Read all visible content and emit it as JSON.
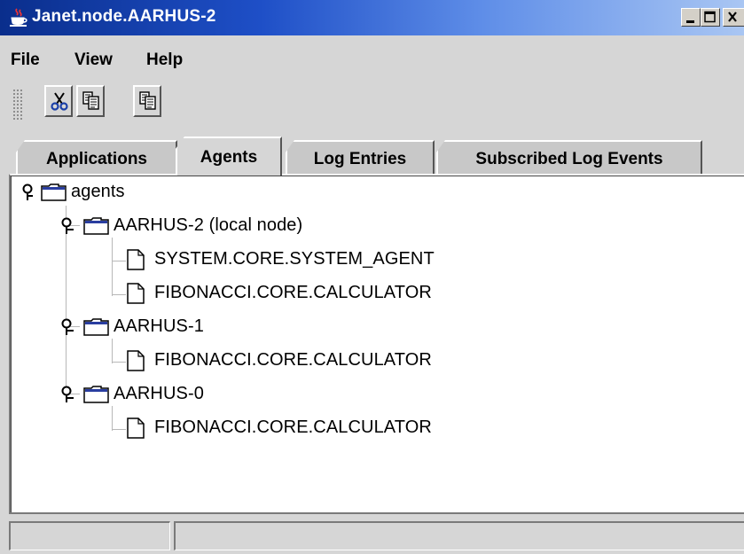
{
  "window": {
    "title": "Janet.node.AARHUS-2",
    "icon": "java-cup-icon",
    "controls": [
      "minimize-icon",
      "maximize-icon",
      "close-icon"
    ]
  },
  "menu": {
    "items": [
      "File",
      "View",
      "Help"
    ]
  },
  "toolbar": {
    "buttons": [
      "cut-icon",
      "copy-icon",
      "paste-icon"
    ]
  },
  "tabs": {
    "items": [
      "Applications",
      "Agents",
      "Log Entries",
      "Subscribed Log Events"
    ],
    "selected": "Agents"
  },
  "tree": {
    "root": {
      "label": "agents",
      "expanded": true,
      "children": [
        {
          "label": "AARHUS-2 (local node)",
          "expanded": true,
          "children": [
            {
              "label": "SYSTEM.CORE.SYSTEM_AGENT"
            },
            {
              "label": "FIBONACCI.CORE.CALCULATOR"
            }
          ]
        },
        {
          "label": "AARHUS-1",
          "expanded": true,
          "children": [
            {
              "label": "FIBONACCI.CORE.CALCULATOR"
            }
          ]
        },
        {
          "label": "AARHUS-0",
          "expanded": true,
          "children": [
            {
              "label": "FIBONACCI.CORE.CALCULATOR"
            }
          ]
        }
      ]
    }
  },
  "statusbar": {
    "cells": [
      "",
      ""
    ]
  }
}
